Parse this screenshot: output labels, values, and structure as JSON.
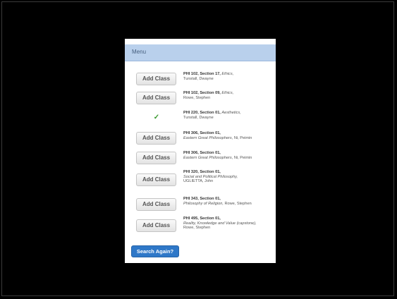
{
  "header": {
    "menu_label": "Menu"
  },
  "add_label": "Add Class",
  "rows": [
    {
      "status": "add",
      "code": "PHI 102, Section 17,",
      "title": "Ethics,",
      "rest": "Tunstall, Dwayne"
    },
    {
      "status": "add",
      "code": "PHI 102, Section 09,",
      "title": "Ethics,",
      "rest": "Rowe, Stephen"
    },
    {
      "status": "added",
      "check_icon": "✓",
      "code": "PHI 220, Section 01,",
      "title": "Aesthetics,",
      "rest": "Tunstall, Dwayne"
    },
    {
      "status": "add",
      "code": "PHI 306, Section 01,",
      "title": "Eastern Great Philosophers,",
      "rest": "Ni, Peimin"
    },
    {
      "status": "add",
      "code": "PHI 306, Section 01,",
      "title": "Eastern Great Philosophers,",
      "rest": "Ni, Peimin"
    },
    {
      "status": "add",
      "code": "PHI 320, Section 01,",
      "title": "Social and Political Philosophy,",
      "rest": "UGLIETTA, John"
    },
    {
      "status": "add",
      "code": "PHI 343, Section 01,",
      "title": "Philosophy of Religion,",
      "rest": "Rowe, Stephen"
    },
    {
      "status": "add",
      "code": "PHI 495, Section 01,",
      "title": "Reality, Knowledge and Value (capstone),",
      "rest": "Rowe, Stephen"
    }
  ],
  "search_again_label": "Search Again?"
}
